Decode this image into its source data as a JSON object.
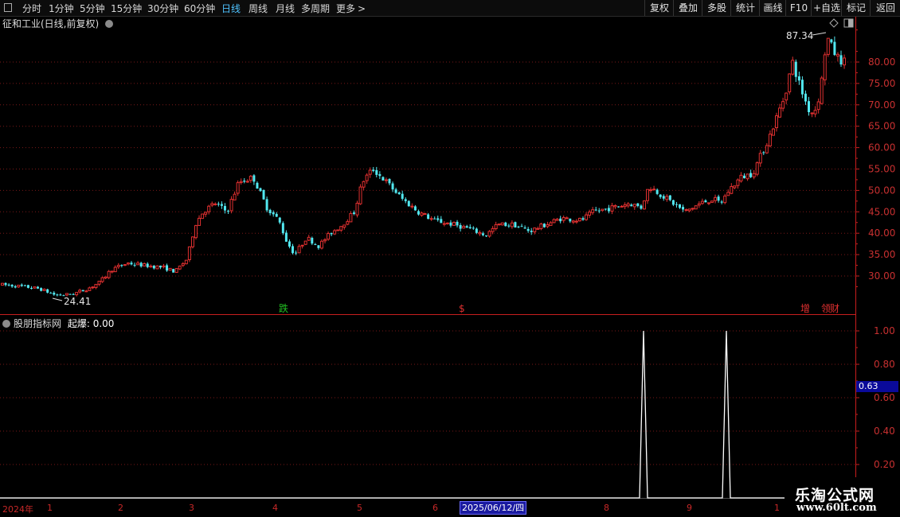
{
  "toolbar": {
    "periods": [
      "分时",
      "1分钟",
      "5分钟",
      "15分钟",
      "30分钟",
      "60分钟",
      "日线",
      "周线",
      "月线",
      "多周期",
      "更多"
    ],
    "active_period": "日线",
    "more_arrow": ">",
    "right_buttons": [
      "复权",
      "叠加",
      "多股",
      "统计",
      "画线",
      "F10",
      "+自选",
      "标记",
      "返回"
    ]
  },
  "main_panel": {
    "title": "征和工业(日线,前复权)",
    "price_axis": [
      "80.00",
      "75.00",
      "70.00",
      "65.00",
      "60.00",
      "55.00",
      "50.00",
      "45.00",
      "40.00",
      "35.00",
      "30.00"
    ],
    "high_label": "87.34",
    "low_label": "24.41",
    "markers": [
      {
        "text": "跌",
        "color": "#22c022"
      },
      {
        "text": "$",
        "color": "#e03030"
      },
      {
        "text": "增",
        "color": "#e03030"
      },
      {
        "text": "领",
        "color": "#e03030"
      },
      {
        "text": "财",
        "color": "#e03030"
      }
    ]
  },
  "indicator_panel": {
    "title": "股朋指标网",
    "series_label": "起爆",
    "series_value": "0.00",
    "axis": [
      "1.00",
      "0.80",
      "0.60",
      "0.40",
      "0.20"
    ],
    "highlight_value": "0.63"
  },
  "time_axis": {
    "year": "2024年",
    "months": [
      "1",
      "2",
      "3",
      "4",
      "5",
      "6",
      "8",
      "9",
      "1"
    ],
    "selected_date": "2025/06/12/四"
  },
  "watermark": {
    "line1": "乐淘公式网",
    "line2": "www.60lt.com"
  },
  "colors": {
    "up": "#e03030",
    "down": "#52e8f0",
    "axis": "#c81e1e",
    "background": "#000000"
  }
}
